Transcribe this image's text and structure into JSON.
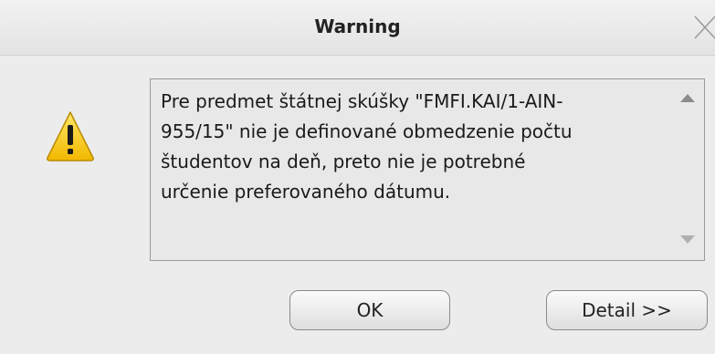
{
  "dialog": {
    "title": "Warning",
    "icon": "warning-icon",
    "message": "Pre predmet štátnej skúšky \"FMFI.KAI/1-AIN-955/15\" nie je definované obmedzenie počtu študentov na deň, preto nie je potrebné určenie preferovaného dátumu.",
    "message_lines": [
      "Pre predmet štátnej skúšky \"FMFI.KAI/1-AIN-",
      "955/15\" nie je definované obmedzenie počtu",
      "študentov na deň, preto nie je potrebné",
      "určenie preferovaného dátumu."
    ],
    "ok_label": "OK",
    "detail_label": "Detail >>"
  },
  "colors": {
    "background": "#ececec",
    "warning_yellow": "#f6c700",
    "border": "#9a9a9a"
  }
}
